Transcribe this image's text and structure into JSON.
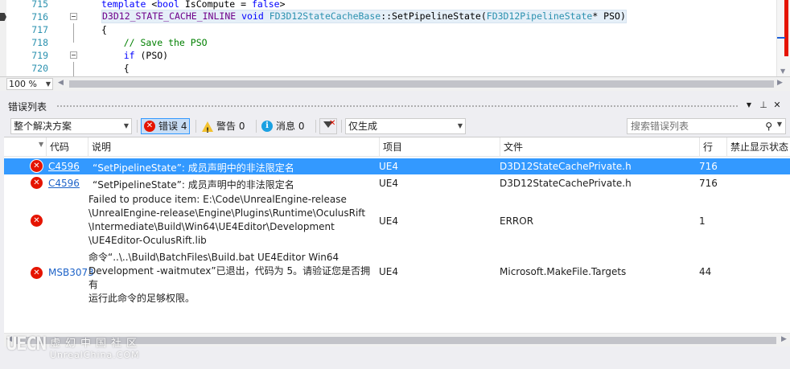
{
  "editor": {
    "lines": [
      {
        "num": "715",
        "tokens": [
          [
            "kw",
            "template "
          ],
          [
            "txt",
            "<"
          ],
          [
            "kw",
            "bool "
          ],
          [
            "txt",
            "IsCompute = "
          ],
          [
            "kw",
            "false"
          ],
          [
            "txt",
            ">"
          ]
        ]
      },
      {
        "num": "716",
        "tokens": [
          [
            "mac",
            "D3D12_STATE_CACHE_INLINE "
          ],
          [
            "kw",
            "void "
          ],
          [
            "typ",
            "FD3D12StateCacheBase"
          ],
          [
            "txt",
            "::SetPipelineState("
          ],
          [
            "typ",
            "FD3D12PipelineState"
          ],
          [
            "txt",
            "* PSO)"
          ]
        ]
      },
      {
        "num": "717",
        "tokens": [
          [
            "txt",
            "{"
          ]
        ]
      },
      {
        "num": "718",
        "tokens": [
          [
            "cmt",
            "    // Save the PSO"
          ]
        ]
      },
      {
        "num": "719",
        "tokens": [
          [
            "kw",
            "    if "
          ],
          [
            "txt",
            "(PSO)"
          ]
        ]
      },
      {
        "num": "720",
        "tokens": [
          [
            "txt",
            "    {"
          ]
        ]
      }
    ],
    "zoom": "100 %"
  },
  "error_list": {
    "title": "错误列表",
    "scope_selected": "整个解决方案",
    "errors_label": "错误 4",
    "warnings_label": "警告 0",
    "messages_label": "消息 0",
    "build_filter_selected": "仅生成",
    "search_placeholder": "搜索错误列表",
    "columns": {
      "code": "代码",
      "description": "说明",
      "project": "项目",
      "file": "文件",
      "line": "行",
      "suppression": "禁止显示状态"
    },
    "rows": [
      {
        "code": "C4596",
        "description": "“SetPipelineState”: 成员声明中的非法限定名",
        "project": "UE4",
        "file": "D3D12StateCachePrivate.h",
        "line": "716"
      },
      {
        "code": "C4596",
        "description": "“SetPipelineState”: 成员声明中的非法限定名",
        "project": "UE4",
        "file": "D3D12StateCachePrivate.h",
        "line": "716"
      },
      {
        "code": "",
        "description_lines": [
          "Failed to produce item: E:\\Code\\UnrealEngine-release",
          "\\UnrealEngine-release\\Engine\\Plugins\\Runtime\\OculusRift",
          "\\Intermediate\\Build\\Win64\\UE4Editor\\Development",
          "\\UE4Editor-OculusRift.lib"
        ],
        "project": "UE4",
        "file": "ERROR",
        "line": "1"
      },
      {
        "code": "MSB3073",
        "description_lines": [
          "命令“..\\..\\Build\\BatchFiles\\Build.bat UE4Editor Win64",
          "Development -waitmutex”已退出，代码为 5。请验证您是否拥有",
          "运行此命令的足够权限。"
        ],
        "project": "UE4",
        "file": "Microsoft.MakeFile.Targets",
        "line": "44"
      }
    ]
  },
  "watermark": {
    "logo": "UECN",
    "name": "虚幻中国社区",
    "site": "UnrealChina.COM"
  },
  "colors": {
    "selection": "#3399ff",
    "error": "#e51400",
    "link": "#1e63c8",
    "line_number": "#2b91af"
  }
}
